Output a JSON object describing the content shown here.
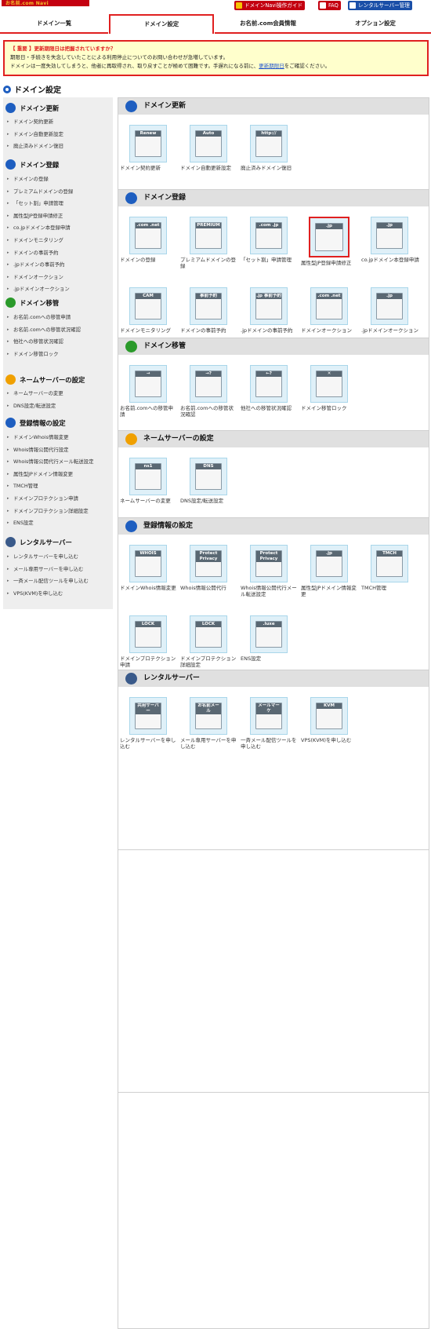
{
  "logo_text": "お名前.com Navi",
  "toplinks": [
    {
      "label": "ドメインNavi操作ガイド",
      "icon": "book-icon",
      "color": "#c40010"
    },
    {
      "label": "FAQ",
      "icon": "question-icon",
      "color": "#c40010"
    },
    {
      "label": "レンタルサーバー管理",
      "icon": "server-icon",
      "color": "#1a4fa8"
    }
  ],
  "tabs": [
    "ドメイン一覧",
    "ドメイン設定",
    "お名前.com会員情報",
    "オプション設定"
  ],
  "active_tab": "ドメイン設定",
  "notice": {
    "heading": "【 重要 】更新期限日は把握されていますか？",
    "line1": "期限日・手続きを失念していたことによる利用停止についてのお問い合わせが急増しています。",
    "line2": "ドメインは一度失効してしまうと、他者に再取得され、取り戻すことが極めて困難です。手遅れになる前に、",
    "link": "更新期限日",
    "line2_end": "をご確認ください。"
  },
  "page_title": "ドメイン設定",
  "sidebar": [
    {
      "title": "ドメイン更新",
      "icon": "refresh-icon",
      "color": "#1e5ec0",
      "items": [
        "ドメイン契約更新",
        "ドメイン自動更新設定",
        "廃止済みドメイン復旧"
      ]
    },
    {
      "title": "ドメイン登録",
      "icon": "plus-icon",
      "color": "#1e5ec0",
      "items": [
        "ドメインの登録",
        "プレミアムドメインの登録",
        "「セット割」申請管理",
        "属性型JP登録申請修正",
        "co.jpドメイン本登録申請",
        "ドメインモニタリング",
        "ドメインの事前予約",
        ".jpドメインの事前予約",
        "ドメインオークション",
        ".jpドメインオークション"
      ]
    },
    {
      "title": "ドメイン移管",
      "icon": "transfer-icon",
      "color": "#2a9a2a",
      "items": [
        "お名前.comへの移管申請",
        "お名前.comへの移管状況確認",
        "他社への移管状況確認",
        "ドメイン移管ロック"
      ]
    },
    {
      "title": "ネームサーバーの設定",
      "icon": "nameserver-icon",
      "color": "#f0a000",
      "items": [
        "ネームサーバーの変更",
        "DNS設定/転送設定"
      ]
    },
    {
      "title": "登録情報の設定",
      "icon": "document-icon",
      "color": "#1e5ec0",
      "items": [
        "ドメインWhois情報変更",
        "Whois情報公開代行設定",
        "Whois情報公開代行メール転送設定",
        "属性型JPドメイン情報変更",
        "TMCH管理",
        "ドメインプロテクション申請",
        "ドメインプロテクション詳細設定",
        "ENS設定"
      ]
    },
    {
      "title": "レンタルサーバー",
      "icon": "server-icon",
      "color": "#3a5a8a",
      "items": [
        "レンタルサーバーを申し込む",
        "メール専用サーバーを申し込む",
        "一斉メール配信ツールを申し込む",
        "VPS(KVM)を申し込む"
      ]
    }
  ],
  "panels": [
    {
      "title": "ドメイン更新",
      "icon": "refresh-icon",
      "color": "#1e5ec0",
      "items": [
        {
          "label": "ドメイン契約更新",
          "icon": "renew-icon",
          "glyph": "Renew"
        },
        {
          "label": "ドメイン自動更新設定",
          "icon": "auto-renew-icon",
          "glyph": "Auto"
        },
        {
          "label": "廃止済みドメイン復旧",
          "icon": "restore-icon",
          "glyph": "http://"
        }
      ]
    },
    {
      "title": "ドメイン登録",
      "icon": "plus-icon",
      "color": "#1e5ec0",
      "items": [
        {
          "label": "ドメインの登録",
          "icon": "domain-register-icon",
          "glyph": ".com .net"
        },
        {
          "label": "プレミアムドメインの登録",
          "icon": "premium-icon",
          "glyph": "PREMIUM"
        },
        {
          "label": "「セット割」申請管理",
          "icon": "cart-icon",
          "glyph": ".com .jp"
        },
        {
          "label": "属性型JP登録申請修正",
          "icon": "jp-edit-icon",
          "glyph": ".jp",
          "highlight": true
        },
        {
          "label": "co.jpドメイン本登録申請",
          "icon": "cojp-icon",
          "glyph": ".jp"
        },
        {
          "label": "ドメインモニタリング",
          "icon": "camera-icon",
          "glyph": "CAM"
        },
        {
          "label": "ドメインの事前予約",
          "icon": "reserve-icon",
          "glyph": "事前予約"
        },
        {
          "label": ".jpドメインの事前予約",
          "icon": "jp-reserve-icon",
          "glyph": ".jp 事前予約"
        },
        {
          "label": "ドメインオークション",
          "icon": "auction-icon",
          "glyph": ".com .net"
        },
        {
          "label": ".jpドメインオークション",
          "icon": "jp-auction-icon",
          "glyph": ".jp"
        }
      ]
    },
    {
      "title": "ドメイン移管",
      "icon": "transfer-icon",
      "color": "#2a9a2a",
      "items": [
        {
          "label": "お名前.comへの移管申請",
          "icon": "transfer-in-icon",
          "glyph": "→"
        },
        {
          "label": "お名前.comへの移管状況確認",
          "icon": "transfer-status-icon",
          "glyph": "→?"
        },
        {
          "label": "他社への移管状況確認",
          "icon": "transfer-out-icon",
          "glyph": "←?"
        },
        {
          "label": "ドメイン移管ロック",
          "icon": "transfer-lock-icon",
          "glyph": "✕"
        }
      ]
    },
    {
      "title": "ネームサーバーの設定",
      "icon": "nameserver-icon",
      "color": "#f0a000",
      "items": [
        {
          "label": "ネームサーバーの変更",
          "icon": "ns-change-icon",
          "glyph": "ns1"
        },
        {
          "label": "DNS設定/転送設定",
          "icon": "dns-icon",
          "glyph": "DNS"
        }
      ]
    },
    {
      "title": "登録情報の設定",
      "icon": "document-icon",
      "color": "#1e5ec0",
      "items": [
        {
          "label": "ドメインWhois情報変更",
          "icon": "whois-icon",
          "glyph": "WHOIS"
        },
        {
          "label": "Whois情報公開代行",
          "icon": "whois-privacy-icon",
          "glyph": "Protect Privacy"
        },
        {
          "label": "Whois情報公開代行メール転送設定",
          "icon": "whois-mail-icon",
          "glyph": "Protect Privacy"
        },
        {
          "label": "属性型JPドメイン情報変更",
          "icon": "jp-info-icon",
          "glyph": ".jp"
        },
        {
          "label": "TMCH管理",
          "icon": "tmch-icon",
          "glyph": "TMCH"
        },
        {
          "label": "ドメインプロテクション申請",
          "icon": "protect-icon",
          "glyph": "LOCK"
        },
        {
          "label": "ドメインプロテクション詳細設定",
          "icon": "protect-detail-icon",
          "glyph": "LOCK"
        },
        {
          "label": "ENS設定",
          "icon": "ens-icon",
          "glyph": ".luxe"
        }
      ]
    },
    {
      "title": "レンタルサーバー",
      "icon": "server-icon",
      "color": "#3a5a8a",
      "items": [
        {
          "label": "レンタルサーバーを申し込む",
          "icon": "shared-server-icon",
          "glyph": "共用サーバー"
        },
        {
          "label": "メール専用サーバーを申し込む",
          "icon": "mail-server-icon",
          "glyph": "お名前メール"
        },
        {
          "label": "一斉メール配信ツールを申し込む",
          "icon": "mass-mail-icon",
          "glyph": "メールマーケ"
        },
        {
          "label": "VPS(KVM)を申し込む",
          "icon": "vps-icon",
          "glyph": "KVM"
        }
      ]
    }
  ]
}
